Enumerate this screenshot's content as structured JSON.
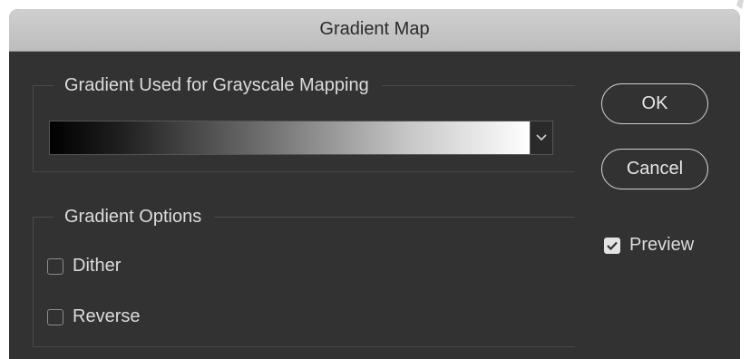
{
  "window": {
    "title": "Gradient Map"
  },
  "gradient_group": {
    "legend": "Gradient Used for Grayscale Mapping",
    "gradient_stops": [
      "#000000",
      "#ffffff"
    ]
  },
  "options_group": {
    "legend": "Gradient Options",
    "dither": {
      "label": "Dither",
      "checked": false
    },
    "reverse": {
      "label": "Reverse",
      "checked": false
    }
  },
  "buttons": {
    "ok_label": "OK",
    "cancel_label": "Cancel"
  },
  "preview": {
    "label": "Preview",
    "checked": true
  },
  "icons": [
    "chevron-down-icon",
    "checkmark-icon"
  ],
  "colors": {
    "dialog_background": "#323232",
    "titlebar": "#c6c6c6",
    "text": "#dcdcdc",
    "checkbox_checked": "#e4e4e4"
  }
}
